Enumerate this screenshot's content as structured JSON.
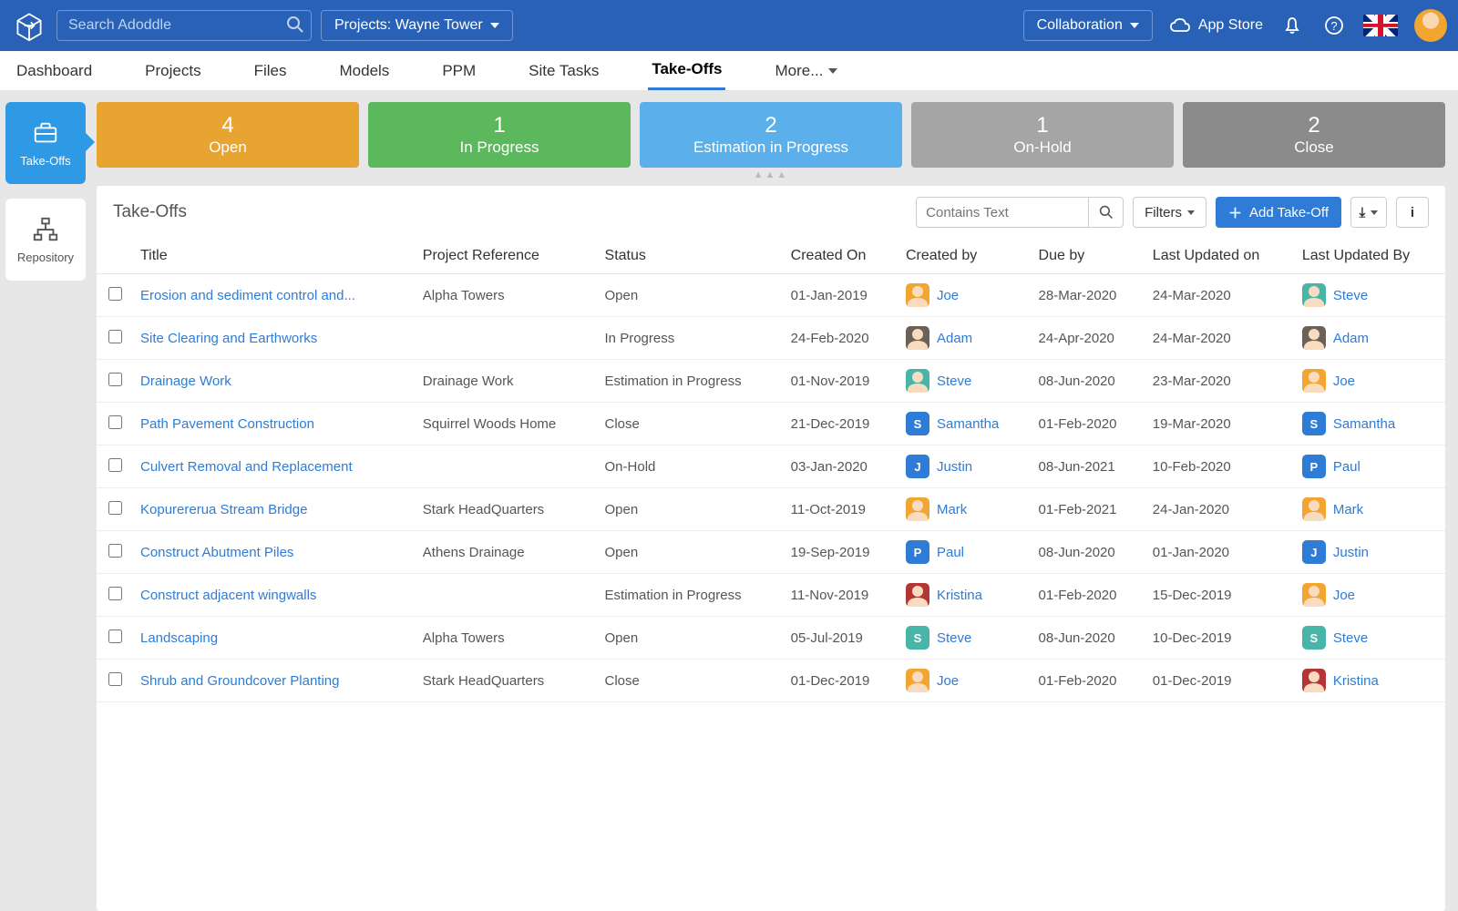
{
  "topbar": {
    "search_placeholder": "Search Adoddle",
    "project_selector": "Projects: Wayne Tower",
    "collaboration": "Collaboration",
    "appstore": "App Store"
  },
  "nav": {
    "tabs": [
      "Dashboard",
      "Projects",
      "Files",
      "Models",
      "PPM",
      "Site Tasks",
      "Take-Offs"
    ],
    "more": "More...",
    "active": "Take-Offs"
  },
  "sidebar": {
    "items": [
      {
        "label": "Take-Offs",
        "active": true
      },
      {
        "label": "Repository",
        "active": false
      }
    ]
  },
  "status_cards": [
    {
      "count": "4",
      "label": "Open",
      "cls": "sc-open"
    },
    {
      "count": "1",
      "label": "In Progress",
      "cls": "sc-prog"
    },
    {
      "count": "2",
      "label": "Estimation in Progress",
      "cls": "sc-est"
    },
    {
      "count": "1",
      "label": "On-Hold",
      "cls": "sc-hold"
    },
    {
      "count": "2",
      "label": "Close",
      "cls": "sc-close"
    }
  ],
  "panel": {
    "title": "Take-Offs",
    "contains_placeholder": "Contains Text",
    "filters": "Filters",
    "add": "Add Take-Off"
  },
  "columns": [
    "Title",
    "Project Reference",
    "Status",
    "Created On",
    "Created by",
    "Due by",
    "Last Updated on",
    "Last Updated By"
  ],
  "avatar_colors": {
    "Joe": "#f2a530",
    "Adam": "#6b6158",
    "Steve": "#48b5a8",
    "Samantha": "#2e7cd6",
    "Justin": "#2e7cd6",
    "Mark": "#f2a530",
    "Paul": "#2e7cd6",
    "Kristina": "#b33535"
  },
  "avatar_letter": {
    "Samantha": "S",
    "Justin": "J",
    "Paul": "P",
    "Steve_alt": "S"
  },
  "rows": [
    {
      "title": "Erosion and sediment control and...",
      "project": "Alpha Towers",
      "status": "Open",
      "created": "01-Jan-2019",
      "by": "Joe",
      "due": "28-Mar-2020",
      "updated": "24-Mar-2020",
      "updby": "Steve",
      "by_img": true,
      "updby_img": true
    },
    {
      "title": "Site Clearing and Earthworks",
      "project": "",
      "status": "In Progress",
      "created": "24-Feb-2020",
      "by": "Adam",
      "due": "24-Apr-2020",
      "updated": "24-Mar-2020",
      "updby": "Adam",
      "by_img": true,
      "updby_img": true
    },
    {
      "title": "Drainage Work",
      "project": "Drainage Work",
      "status": "Estimation in Progress",
      "created": "01-Nov-2019",
      "by": "Steve",
      "due": "08-Jun-2020",
      "updated": "23-Mar-2020",
      "updby": "Joe",
      "by_img": true,
      "updby_img": true
    },
    {
      "title": "Path Pavement Construction",
      "project": "Squirrel Woods Home",
      "status": "Close",
      "created": "21-Dec-2019",
      "by": "Samantha",
      "due": "01-Feb-2020",
      "updated": "19-Mar-2020",
      "updby": "Samantha",
      "by_letter": "S",
      "updby_letter": "S"
    },
    {
      "title": "Culvert Removal and Replacement",
      "project": "",
      "status": "On-Hold",
      "created": "03-Jan-2020",
      "by": "Justin",
      "due": "08-Jun-2021",
      "updated": "10-Feb-2020",
      "updby": "Paul",
      "by_letter": "J",
      "updby_letter": "P"
    },
    {
      "title": "Kopurererua Stream Bridge",
      "project": "Stark HeadQuarters",
      "status": "Open",
      "created": "11-Oct-2019",
      "by": "Mark",
      "due": "01-Feb-2021",
      "updated": "24-Jan-2020",
      "updby": "Mark",
      "by_img": true,
      "updby_img": true
    },
    {
      "title": "Construct Abutment Piles",
      "project": "Athens Drainage",
      "status": "Open",
      "created": "19-Sep-2019",
      "by": "Paul",
      "due": "08-Jun-2020",
      "updated": "01-Jan-2020",
      "updby": "Justin",
      "by_letter": "P",
      "updby_letter": "J"
    },
    {
      "title": "Construct adjacent wingwalls",
      "project": "",
      "status": "Estimation in Progress",
      "created": "11-Nov-2019",
      "by": "Kristina",
      "due": "01-Feb-2020",
      "updated": "15-Dec-2019",
      "updby": "Joe",
      "by_img": true,
      "updby_img": true
    },
    {
      "title": "Landscaping",
      "project": "Alpha Towers",
      "status": "Open",
      "created": "05-Jul-2019",
      "by": "Steve",
      "due": "08-Jun-2020",
      "updated": "10-Dec-2019",
      "updby": "Steve",
      "by_letter": "S",
      "updby_letter": "S"
    },
    {
      "title": "Shrub and Groundcover Planting",
      "project": "Stark HeadQuarters",
      "status": "Close",
      "created": "01-Dec-2019",
      "by": "Joe",
      "due": "01-Feb-2020",
      "updated": "01-Dec-2019",
      "updby": "Kristina",
      "by_img": true,
      "updby_img": true
    }
  ]
}
